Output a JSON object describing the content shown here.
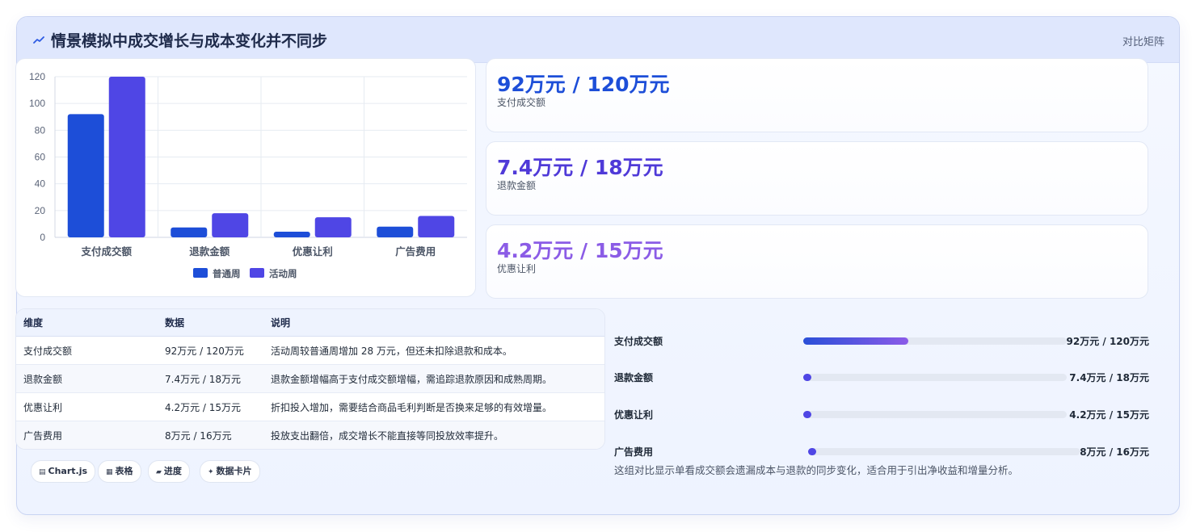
{
  "header": {
    "title": "情景模拟中成交增长与成本变化并不同步",
    "tag": "对比矩阵"
  },
  "colors": {
    "normal_week": "#1d4ed8",
    "event_week": "#4f46e5",
    "stat_1": "#1d4ed8",
    "stat_2": "#4f3ad8",
    "stat_3": "#8b5ce6"
  },
  "chart_data": {
    "type": "bar",
    "categories": [
      "支付成交额",
      "退款金额",
      "优惠让利",
      "广告费用"
    ],
    "series": [
      {
        "name": "普通周",
        "values": [
          92,
          7.4,
          4.2,
          8
        ]
      },
      {
        "name": "活动周",
        "values": [
          120,
          18,
          15,
          16
        ]
      }
    ],
    "ylim": [
      0,
      120
    ],
    "yticks": [
      "0",
      "20",
      "40",
      "60",
      "80",
      "100",
      "120"
    ],
    "grid": true,
    "legend": "bottom"
  },
  "stats": [
    {
      "value": "92万元 / 120万元",
      "label": "支付成交额"
    },
    {
      "value": "7.4万元 / 18万元",
      "label": "退款金额"
    },
    {
      "value": "4.2万元 / 15万元",
      "label": "优惠让利"
    }
  ],
  "table": {
    "headers": [
      "维度",
      "数据",
      "说明"
    ],
    "rows": [
      [
        "支付成交额",
        "92万元 / 120万元",
        "活动周较普通周增加 28 万元，但还未扣除退款和成本。"
      ],
      [
        "退款金额",
        "7.4万元 / 18万元",
        "退款金额增幅高于支付成交额增幅，需追踪退款原因和成熟周期。"
      ],
      [
        "优惠让利",
        "4.2万元 / 15万元",
        "折扣投入增加，需要结合商品毛利判断是否换来足够的有效增量。"
      ],
      [
        "广告费用",
        "8万元 / 16万元",
        "投放支出翻倍，成交增长不能直接等同投放效率提升。"
      ]
    ]
  },
  "progress": [
    {
      "label": "支付成交额",
      "value": "92万元 / 120万元",
      "fraction": 0.4
    },
    {
      "label": "退款金额",
      "value": "7.4万元 / 18万元",
      "fraction": 0.03
    },
    {
      "label": "优惠让利",
      "value": "4.2万元 / 15万元",
      "fraction": 0.03
    },
    {
      "label": "广告费用",
      "value": "8万元 / 16万元",
      "fraction": 0.03
    }
  ],
  "note": "这组对比显示单看成交额会遗漏成本与退款的同步变化，适合用于引出净收益和增量分析。",
  "chips": [
    {
      "icon": "▤",
      "label": "Chart.js"
    },
    {
      "icon": "▦",
      "label": "表格"
    },
    {
      "icon": "▰",
      "label": "进度"
    },
    {
      "icon": "✦",
      "label": "数据卡片"
    }
  ]
}
